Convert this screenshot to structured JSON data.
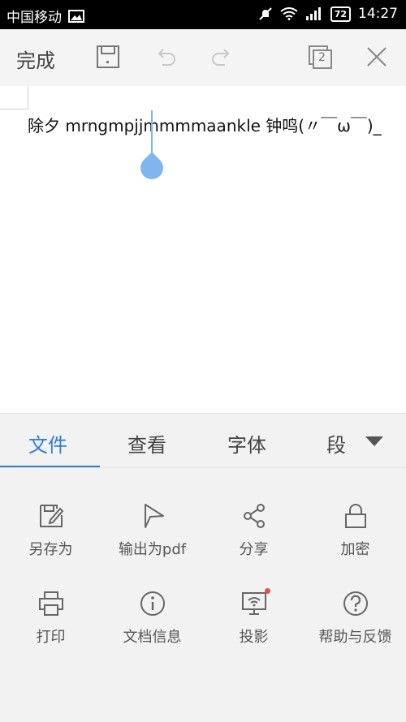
{
  "status": {
    "carrier": "中国移动",
    "battery": "72",
    "time": "14:27"
  },
  "toolbar": {
    "done_label": "完成",
    "page_count": "2"
  },
  "document": {
    "text": "除夕 mrngmpjjmmmmaankle 钟鸣(〃￣ω￣)_"
  },
  "tabs": [
    {
      "label": "文件"
    },
    {
      "label": "查看"
    },
    {
      "label": "字体"
    },
    {
      "label": "段"
    }
  ],
  "file_menu": [
    {
      "label": "另存为",
      "icon": "save-as-icon"
    },
    {
      "label": "输出为pdf",
      "icon": "send-icon"
    },
    {
      "label": "分享",
      "icon": "share-icon"
    },
    {
      "label": "加密",
      "icon": "lock-icon"
    },
    {
      "label": "打印",
      "icon": "print-icon"
    },
    {
      "label": "文档信息",
      "icon": "info-icon"
    },
    {
      "label": "投影",
      "icon": "projection-icon"
    },
    {
      "label": "帮助与反馈",
      "icon": "help-icon"
    }
  ],
  "colors": {
    "accent": "#2f7bd8",
    "cursor": "#7fb6ef",
    "notification_dot": "#e84b4b"
  }
}
